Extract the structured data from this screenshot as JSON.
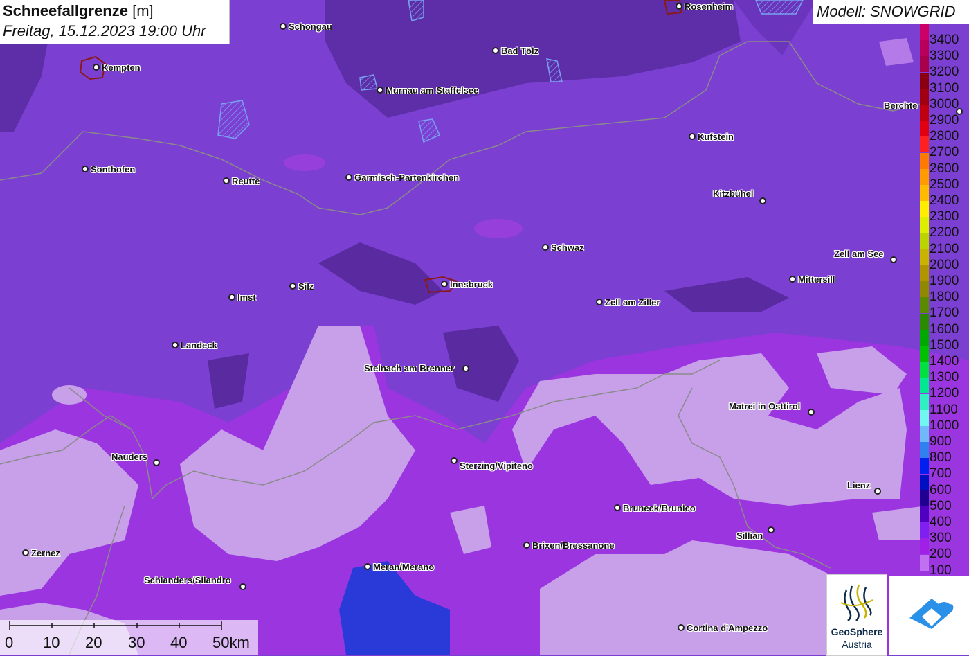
{
  "title": {
    "main": "Schneefallgrenze",
    "unit": "[m]",
    "datetime": "Freitag, 15.12.2023 19:00 Uhr"
  },
  "model": {
    "label": "Modell: SNOWGRID"
  },
  "cities": [
    {
      "name": "Rosenheim"
    },
    {
      "name": "Schongau"
    },
    {
      "name": "Kempten"
    },
    {
      "name": "Bad Tölz"
    },
    {
      "name": "Murnau am Staffelsee"
    },
    {
      "name": "Berchte"
    },
    {
      "name": "Kufstein"
    },
    {
      "name": "Sonthofen"
    },
    {
      "name": "Reutte"
    },
    {
      "name": "Garmisch-Partenkirchen"
    },
    {
      "name": "Kitzbühel"
    },
    {
      "name": "Schwaz"
    },
    {
      "name": "Zell am See"
    },
    {
      "name": "Mittersill"
    },
    {
      "name": "Innsbruck"
    },
    {
      "name": "Silz"
    },
    {
      "name": "Imst"
    },
    {
      "name": "Zell am Ziller"
    },
    {
      "name": "Landeck"
    },
    {
      "name": "Steinach am Brenner"
    },
    {
      "name": "Matrei in Osttirol"
    },
    {
      "name": "Nauders"
    },
    {
      "name": "Sterzing/Vipiteno"
    },
    {
      "name": "Lienz"
    },
    {
      "name": "Bruneck/Brunico"
    },
    {
      "name": "Sillian"
    },
    {
      "name": "Brixen/Bressanone"
    },
    {
      "name": "Zernez"
    },
    {
      "name": "Meran/Merano"
    },
    {
      "name": "Schlanders/Silandro"
    },
    {
      "name": "Cortina d'Ampezzo"
    }
  ],
  "legend": {
    "items": [
      {
        "value": "3400",
        "color": "#cc0066"
      },
      {
        "value": "3300",
        "color": "#b8005a"
      },
      {
        "value": "3200",
        "color": "#a8004a"
      },
      {
        "value": "3100",
        "color": "#8a0010"
      },
      {
        "value": "3000",
        "color": "#a00010"
      },
      {
        "value": "2900",
        "color": "#c00010"
      },
      {
        "value": "2800",
        "color": "#e00010"
      },
      {
        "value": "2700",
        "color": "#ff2020"
      },
      {
        "value": "2600",
        "color": "#ff7a00"
      },
      {
        "value": "2500",
        "color": "#ff9a00"
      },
      {
        "value": "2400",
        "color": "#ffbb00"
      },
      {
        "value": "2300",
        "color": "#ffee00"
      },
      {
        "value": "2200",
        "color": "#ddee00"
      },
      {
        "value": "2100",
        "color": "#bbd400"
      },
      {
        "value": "2000",
        "color": "#c8b400"
      },
      {
        "value": "1900",
        "color": "#b09400"
      },
      {
        "value": "1800",
        "color": "#908800"
      },
      {
        "value": "1700",
        "color": "#5a8a00"
      },
      {
        "value": "1600",
        "color": "#2a8a00"
      },
      {
        "value": "1500",
        "color": "#00a800"
      },
      {
        "value": "1400",
        "color": "#00c000"
      },
      {
        "value": "1300",
        "color": "#00e040"
      },
      {
        "value": "1200",
        "color": "#00e890"
      },
      {
        "value": "1100",
        "color": "#30f0c0"
      },
      {
        "value": "1000",
        "color": "#70f8f0"
      },
      {
        "value": "900",
        "color": "#70b8f8"
      },
      {
        "value": "800",
        "color": "#3080f0"
      },
      {
        "value": "700",
        "color": "#0020f0"
      },
      {
        "value": "600",
        "color": "#0010c0"
      },
      {
        "value": "500",
        "color": "#200090"
      },
      {
        "value": "400",
        "color": "#5000c0"
      },
      {
        "value": "300",
        "color": "#8020f0"
      },
      {
        "value": "200",
        "color": "#a020e8"
      },
      {
        "value": "100",
        "color": "#c070f0"
      }
    ]
  },
  "scale": {
    "labels": [
      "0",
      "10",
      "20",
      "30",
      "40",
      "50km"
    ]
  },
  "logos": {
    "geosphere_name": "GeoSphere",
    "geosphere_sub": "Austria"
  },
  "colors": {
    "base_purple": "#7a3fd0",
    "dark_purple": "#5a2aa0",
    "light_purple": "#c49ae8",
    "magenta_band": "#a030e0",
    "blue_area": "#2a3ad8"
  }
}
